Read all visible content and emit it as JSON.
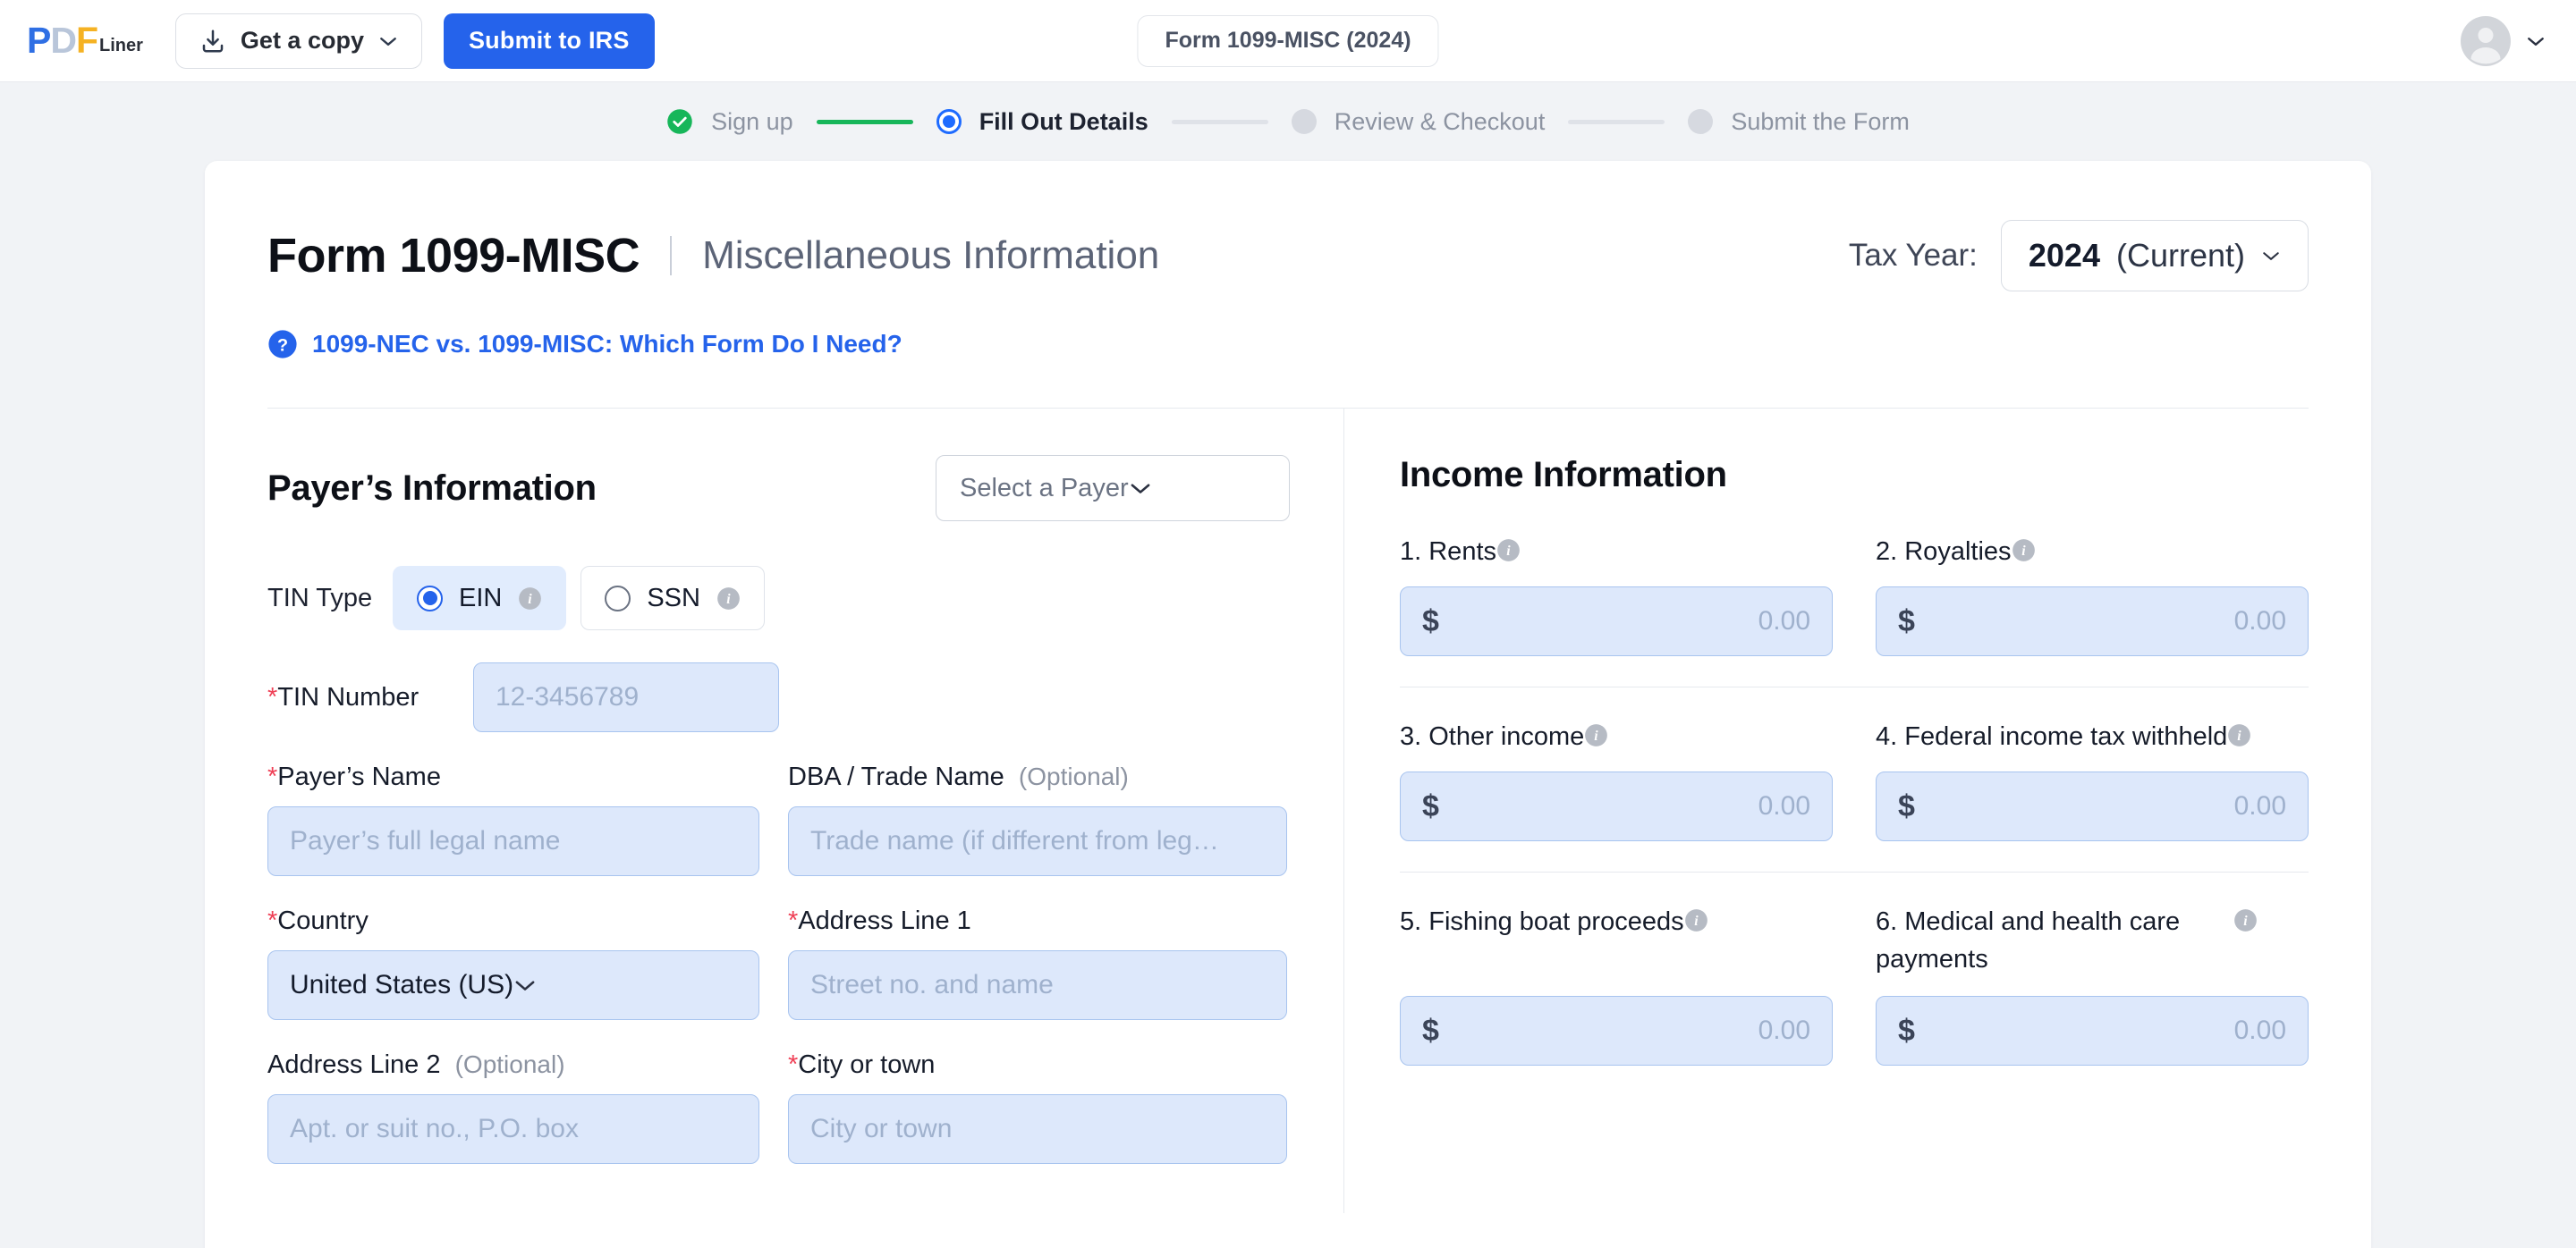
{
  "topbar": {
    "logo_p": "P",
    "logo_d": "D",
    "logo_f": "F",
    "logo_word": "Liner",
    "get_copy_label": "Get a copy",
    "submit_irs_label": "Submit to IRS",
    "form_chip_label": "Form 1099-MISC (2024)",
    "download_icon": "download-icon",
    "chevron_icon": "chevron-down-icon",
    "avatar_icon": "avatar-icon"
  },
  "stepper": {
    "steps": [
      {
        "label": "Sign up",
        "state": "done"
      },
      {
        "label": "Fill Out Details",
        "state": "active"
      },
      {
        "label": "Review & Checkout",
        "state": "todo"
      },
      {
        "label": "Submit the Form",
        "state": "todo"
      }
    ]
  },
  "header": {
    "form_title": "Form 1099-MISC",
    "separator": "|",
    "form_subtitle": "Miscellaneous Information",
    "tax_year_label": "Tax Year:",
    "tax_year_value": "2024",
    "tax_year_suffix": "(Current)",
    "help_link": "1099-NEC vs. 1099-MISC: Which Form Do I Need?",
    "help_icon": "question-circle-icon"
  },
  "payer": {
    "section_title": "Payer’s Information",
    "select_payer_placeholder": "Select a Payer",
    "tin_type_label": "TIN Type",
    "tin_options": [
      {
        "label": "EIN",
        "selected": true
      },
      {
        "label": "SSN",
        "selected": false
      }
    ],
    "tin_number_label": "TIN Number",
    "tin_number_required": "*",
    "tin_number_placeholder": "12-3456789",
    "fields": [
      {
        "label": "Payer’s Name",
        "required": "*",
        "optional": "",
        "placeholder": "Payer’s full legal name",
        "type": "input"
      },
      {
        "label": "DBA / Trade Name",
        "required": "",
        "optional": "(Optional)",
        "placeholder": "Trade name (if different from leg…",
        "type": "input"
      },
      {
        "label": "Country",
        "required": "*",
        "optional": "",
        "value": "United States (US)",
        "type": "select"
      },
      {
        "label": "Address Line 1",
        "required": "*",
        "optional": "",
        "placeholder": "Street no. and name",
        "type": "input"
      },
      {
        "label": "Address Line 2",
        "required": "",
        "optional": "(Optional)",
        "placeholder": "Apt. or suit no., P.O. box",
        "type": "input"
      },
      {
        "label": "City or town",
        "required": "*",
        "optional": "",
        "placeholder": "City or town",
        "type": "input"
      }
    ]
  },
  "income": {
    "section_title": "Income Information",
    "currency_symbol": "$",
    "default_amount": "0.00",
    "boxes": [
      {
        "label": "1. Rents",
        "amount": "0.00"
      },
      {
        "label": "2. Royalties",
        "amount": "0.00"
      },
      {
        "label": "3. Other income",
        "amount": "0.00"
      },
      {
        "label": "4. Federal income tax withheld",
        "amount": "0.00"
      },
      {
        "label": "5. Fishing boat proceeds",
        "amount": "0.00"
      },
      {
        "label": "6. Medical and health care payments",
        "amount": "0.00"
      }
    ]
  },
  "colors": {
    "brand_blue": "#2563eb",
    "accent_blue": "#1e6bff",
    "success_green": "#17b65a",
    "required_red": "#ef4056",
    "input_fill": "#dde8fb",
    "page_bg": "#f1f3f6"
  }
}
